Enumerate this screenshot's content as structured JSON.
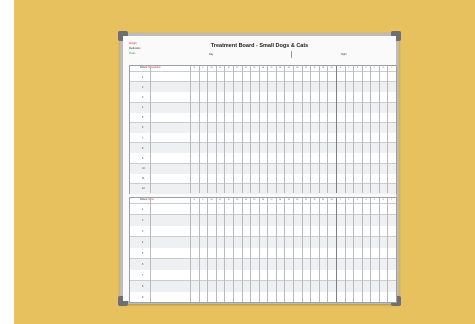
{
  "board": {
    "title": "Treatment Board - Small Dogs & Cats",
    "legend": {
      "red": "Weight",
      "black": "Medication",
      "green": "Fluids"
    },
    "header": {
      "day_label": "Day",
      "night_label": "Night"
    },
    "section1": {
      "label": "Patient",
      "sub": "Name/Admit"
    },
    "section2": {
      "label": "Patient",
      "sub": "Name"
    },
    "time_columns": [
      "8",
      "9",
      "10",
      "11",
      "12",
      "13",
      "14",
      "15",
      "16",
      "17",
      "18",
      "19",
      "20",
      "21",
      "22",
      "23",
      "24",
      "1",
      "2",
      "3",
      "4",
      "5",
      "6",
      "7"
    ],
    "rows_section1": [
      "1",
      "2",
      "3",
      "4",
      "5",
      "6",
      "7",
      "8",
      "9",
      "10",
      "11",
      "12"
    ],
    "rows_section2": [
      "1",
      "2",
      "3",
      "4",
      "5",
      "6",
      "7",
      "8",
      "9"
    ]
  }
}
